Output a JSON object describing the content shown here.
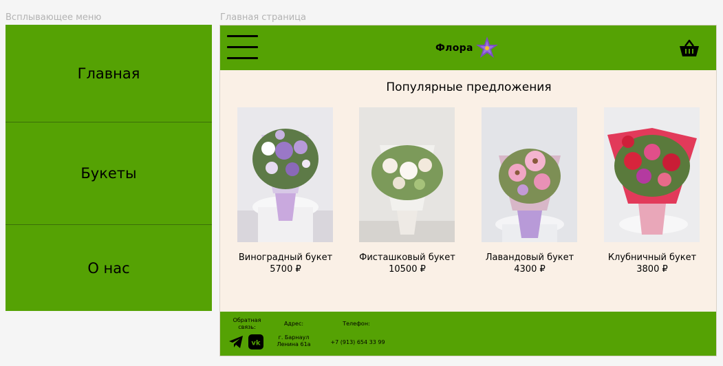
{
  "frames": {
    "menu_label": "Всплывающее меню",
    "main_label": "Главная страница"
  },
  "menu": {
    "items": [
      {
        "label": "Главная"
      },
      {
        "label": "Букеты"
      },
      {
        "label": "О нас"
      }
    ]
  },
  "header": {
    "logo_text": "Флора",
    "brand_color": "#55a204",
    "icons": [
      "hamburger-menu-icon",
      "flower-logo-icon",
      "shopping-basket-icon"
    ]
  },
  "main": {
    "section_title": "Популярные предложения",
    "background": "#faf0e6",
    "products": [
      {
        "name": "Виноградный букет",
        "price": "5700 ₽"
      },
      {
        "name": "Фисташковый букет",
        "price": "10500 ₽"
      },
      {
        "name": "Лавандовый букет",
        "price": "4300 ₽"
      },
      {
        "name": "Клубничный букет",
        "price": "3800 ₽"
      }
    ]
  },
  "footer": {
    "feedback_label": "Обратная связь:",
    "address_label": "Адрес:",
    "address_value": "г. Барнаул Ленина 61а",
    "phone_label": "Телефон:",
    "phone_value": "+7 (913) 654 33 99",
    "social_icons": [
      "telegram-icon",
      "vk-icon"
    ]
  }
}
